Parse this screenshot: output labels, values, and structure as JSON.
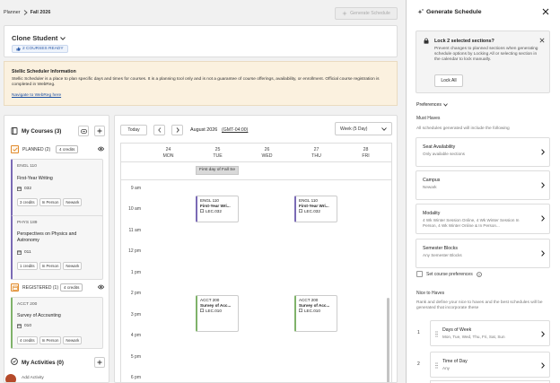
{
  "breadcrumb": {
    "root": "Planner",
    "current": "Fall 2026"
  },
  "generate_button": "Generate Schedule",
  "student": {
    "name": "Clone Student",
    "ready_badge": "2 COURSES READY"
  },
  "info": {
    "title": "Stellic Scheduler Information",
    "body": "Stellic Scheduler is a place to plan specific days and times for courses. It is a planning tool only and is not a guarantee of course offerings, availability, or enrollment. Official course registration is completed in WebReg.",
    "link": "Navigate to WebReg here"
  },
  "courses_panel": {
    "title": "My Courses (3)",
    "planned": {
      "label": "PLANNED (2)",
      "credits": "4 credits"
    },
    "registered": {
      "label": "REGISTERED (1)",
      "credits": "4 credits"
    },
    "activities": "My Activities (0)",
    "add_activity": "Add Activity",
    "cards": [
      {
        "code": "ENGL 110",
        "title": "First-Year Writing",
        "section": "032",
        "tags": [
          "3 credits",
          "In Person",
          "Newark"
        ]
      },
      {
        "code": "PHYS 189",
        "title": "Perspectives on Physics and Astronomy",
        "section": "011",
        "tags": [
          "1 credits",
          "In Person",
          "Newark"
        ]
      },
      {
        "code": "ACCT 200",
        "title": "Survey of Accounting",
        "section": "010",
        "tags": [
          "4 credits",
          "In Person",
          "Newark"
        ]
      }
    ]
  },
  "calendar": {
    "today": "Today",
    "month": "August 2026",
    "timezone": "(GMT-04:00)",
    "view": "Week (5 Day)",
    "days": [
      {
        "num": "24",
        "name": "MON"
      },
      {
        "num": "25",
        "name": "TUE"
      },
      {
        "num": "26",
        "name": "WED"
      },
      {
        "num": "27",
        "name": "THU"
      },
      {
        "num": "28",
        "name": "FRI"
      }
    ],
    "allday_event": "First day of Fall Se",
    "times": [
      "9 am",
      "10 am",
      "11 am",
      "12 pm",
      "1 pm",
      "2 pm",
      "3 pm",
      "4 pm",
      "5 pm",
      "6 pm"
    ],
    "events": [
      {
        "code": "ENGL 110",
        "title": "First-Year Wri...",
        "section": "LEC.032"
      },
      {
        "code": "ENGL 110",
        "title": "First-Year Wri...",
        "section": "LEC.032"
      },
      {
        "code": "ACCT 200",
        "title": "Survey of Acc...",
        "section": "LEC.010"
      },
      {
        "code": "ACCT 200",
        "title": "Survey of Acc...",
        "section": "LEC.010"
      }
    ]
  },
  "drawer": {
    "title": "Generate Schedule",
    "lock": {
      "title": "Lock 2 selected sections?",
      "body": "Prevent changes to planned sections when generating schedule options by Locking All or selecting section in the calendar to lock manually.",
      "button": "Lock All"
    },
    "preferences": "Preferences",
    "must_haves": "Must Haves",
    "must_haves_desc": "All schedules generated will include the following",
    "options": [
      {
        "title": "Seat Availability",
        "sub": "Only available sections"
      },
      {
        "title": "Campus",
        "sub": "Newark"
      },
      {
        "title": "Modality",
        "sub": "4 Wk Winter Session Online, 4 Wk Winter Session In Person, 4 Wk Winter Online & In Person..."
      },
      {
        "title": "Semester Blocks",
        "sub": "Any Semester Blocks"
      }
    ],
    "set_course_prefs": "Set course preferences",
    "nice_to_haves": "Nice to Haves",
    "nice_desc": "Rank and define your nice to haves and the best schedules will be generated that incorporate these",
    "nice_items": [
      {
        "rank": "1",
        "title": "Days of Week",
        "sub": "Mon, Tue, Wed, Thu, Fri, Sat, Sun"
      },
      {
        "rank": "2",
        "title": "Time of Day",
        "sub": "Any"
      }
    ]
  },
  "colors": {
    "accent": "#1b4fa3",
    "banner": "#fbf1df",
    "planned": "#7a6ab5",
    "registered": "#7fb26a",
    "planned_icon": "#e08a2c"
  }
}
